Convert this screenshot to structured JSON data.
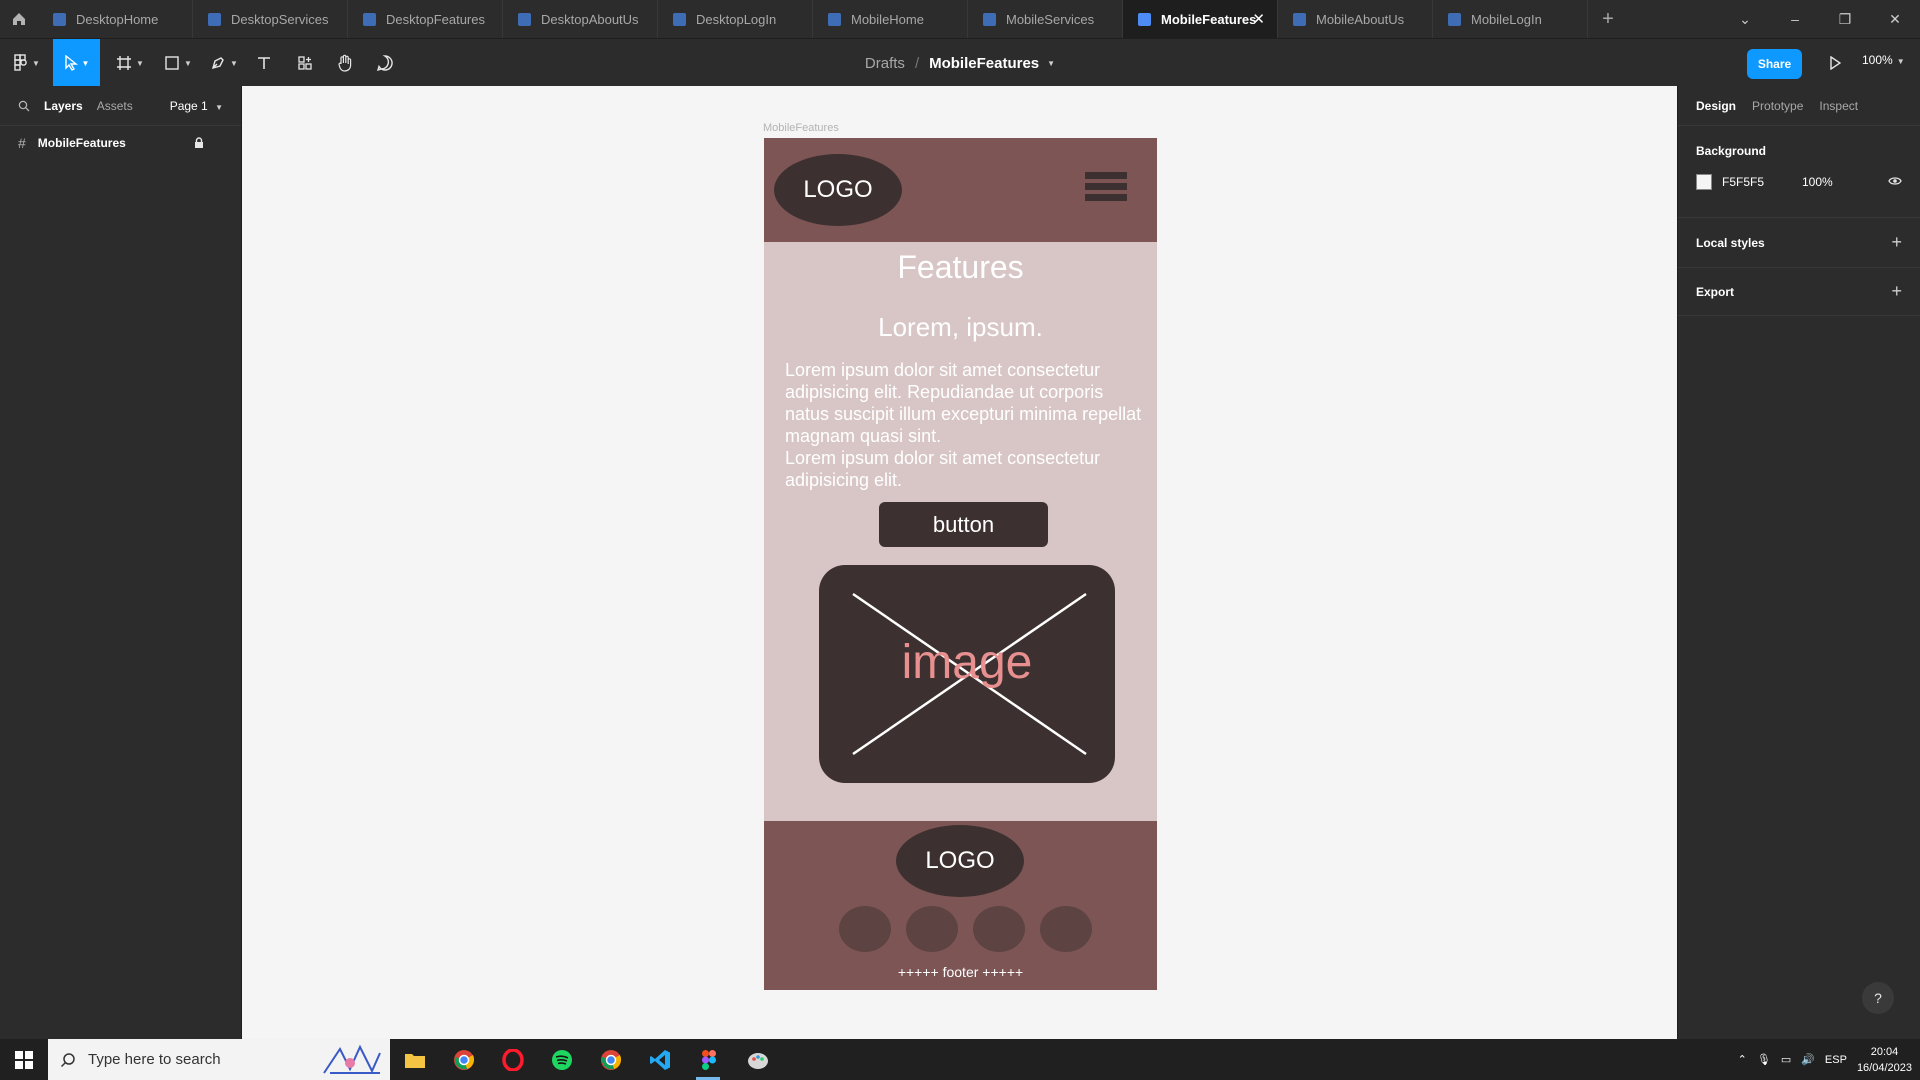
{
  "tabs": [
    {
      "label": "DesktopHome"
    },
    {
      "label": "DesktopServices"
    },
    {
      "label": "DesktopFeatures"
    },
    {
      "label": "DesktopAboutUs"
    },
    {
      "label": "DesktopLogIn"
    },
    {
      "label": "MobileHome"
    },
    {
      "label": "MobileServices"
    },
    {
      "label": "MobileFeatures"
    },
    {
      "label": "MobileAboutUs"
    },
    {
      "label": "MobileLogIn"
    }
  ],
  "toolbar": {
    "breadcrumb_drafts": "Drafts",
    "breadcrumb_sep": "/",
    "file_name": "MobileFeatures",
    "share_label": "Share",
    "zoom": "100%"
  },
  "left_panel": {
    "tab_layers": "Layers",
    "tab_assets": "Assets",
    "page": "Page 1",
    "layers": [
      {
        "name": "MobileFeatures"
      }
    ]
  },
  "canvas": {
    "frame_label": "MobileFeatures",
    "background_color": "#F5F5F5",
    "mockup": {
      "header_logo": "LOGO",
      "title": "Features",
      "subtitle": "Lorem, ipsum.",
      "body": "Lorem ipsum dolor sit amet consectetur adipisicing elit. Repudiandae ut corporis natus suscipit illum excepturi minima repellat magnam quasi sint.\nLorem ipsum dolor sit amet consectetur adipisicing elit.",
      "button": "button",
      "image_label": "image",
      "footer_logo": "LOGO",
      "footer_text": "+++++ footer +++++",
      "social_count": 4,
      "colors": {
        "header": "#7D5555",
        "body": "#D8C6C6",
        "dark": "#3D3030",
        "image_text": "#E89090"
      }
    }
  },
  "right_panel": {
    "tab_design": "Design",
    "tab_prototype": "Prototype",
    "tab_inspect": "Inspect",
    "background_heading": "Background",
    "background_hex": "F5F5F5",
    "background_opacity": "100%",
    "local_styles": "Local styles",
    "export": "Export"
  },
  "taskbar": {
    "search_placeholder": "Type here to search",
    "language": "ESP",
    "time": "20:04",
    "date": "16/04/2023"
  }
}
